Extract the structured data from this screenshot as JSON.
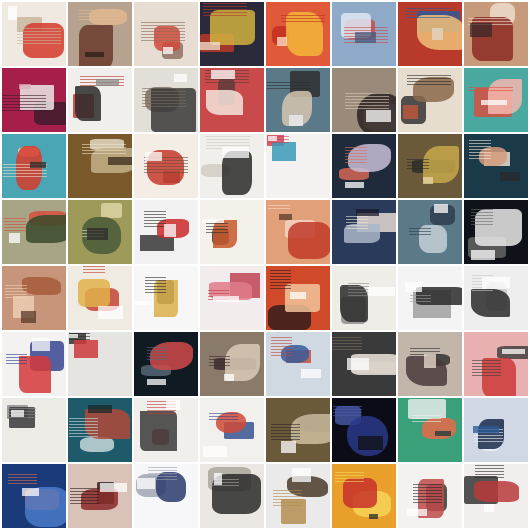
{
  "grid": {
    "rows": 8,
    "cols": 8,
    "background": "#ffffff",
    "tiles": [
      {
        "bg": "#efe9e2",
        "c1": "#d33a2c",
        "c2": "#c7b49a",
        "c3": "#ffffff"
      },
      {
        "bg": "#b7a28f",
        "c1": "#6a3b2b",
        "c2": "#e2b98f",
        "c3": "#2b1d18"
      },
      {
        "bg": "#e7ddd3",
        "c1": "#cf4a3a",
        "c2": "#8a6a5a",
        "c3": "#ffffff"
      },
      {
        "bg": "#2b2a3a",
        "c1": "#d0b140",
        "c2": "#c03a2a",
        "c3": "#f1e4cc"
      },
      {
        "bg": "#e05a3a",
        "c1": "#f2b63a",
        "c2": "#c22a22",
        "c3": "#ffe6c8"
      },
      {
        "bg": "#8fa9c9",
        "c1": "#dfe8f2",
        "c2": "#c44b4b",
        "c3": "#4a5a7a"
      },
      {
        "bg": "#b83a2b",
        "c1": "#f0c07a",
        "c2": "#2a5a9a",
        "c3": "#e3d7ca"
      },
      {
        "bg": "#c89a7c",
        "c1": "#8c2a22",
        "c2": "#efe0d0",
        "c3": "#3a2a2a"
      },
      {
        "bg": "#a61f4a",
        "c1": "#ece6e6",
        "c2": "#3a1a2a",
        "c3": "#d7b0b8"
      },
      {
        "bg": "#f0efec",
        "c1": "#2a2a2a",
        "c2": "#bb3030",
        "c3": "#8a8a8a"
      },
      {
        "bg": "#e2ded8",
        "c1": "#3a3a3a",
        "c2": "#7a6a5a",
        "c3": "#ffffff"
      },
      {
        "bg": "#c84a4a",
        "c1": "#f4e4dc",
        "c2": "#5a3a3a",
        "c3": "#ffffff"
      },
      {
        "bg": "#5a7a8a",
        "c1": "#d7c6b0",
        "c2": "#2a2a2a",
        "c3": "#eef2f4"
      },
      {
        "bg": "#9a8a7a",
        "c1": "#2a2222",
        "c2": "#d9c9b6",
        "c3": "#ffffff"
      },
      {
        "bg": "#e6ddcf",
        "c1": "#8a6a4a",
        "c2": "#2a2a2a",
        "c3": "#c85a3a"
      },
      {
        "bg": "#49a8a0",
        "c1": "#f3b7b0",
        "c2": "#e04a3a",
        "c3": "#ffffff"
      },
      {
        "bg": "#4aa6b4",
        "c1": "#d83a2a",
        "c2": "#f4dcc8",
        "c3": "#2a2a2a"
      },
      {
        "bg": "#7a5a2a",
        "c1": "#c4b08a",
        "c2": "#e9e0cc",
        "c3": "#3a2a1a"
      },
      {
        "bg": "#f3ede6",
        "c1": "#c43a2a",
        "c2": "#6a4a3a",
        "c3": "#ffffff"
      },
      {
        "bg": "#f1efeb",
        "c1": "#2a2a2a",
        "c2": "#cfcac2",
        "c3": "#ffffff"
      },
      {
        "bg": "#f4f2f0",
        "c1": "#3a9ab8",
        "c2": "#d03a4a",
        "c3": "#ffffff"
      },
      {
        "bg": "#1f2a3a",
        "c1": "#c8c0d8",
        "c2": "#e06a5a",
        "c3": "#ffffff"
      },
      {
        "bg": "#6a5a3a",
        "c1": "#c5a84a",
        "c2": "#2a2a2a",
        "c3": "#e8d8a8"
      },
      {
        "bg": "#1a3a4a",
        "c1": "#d59a7a",
        "c2": "#f3e8d8",
        "c3": "#2a2a2a"
      },
      {
        "bg": "#a8a486",
        "c1": "#3a4a2a",
        "c2": "#d74a3a",
        "c3": "#ffffff"
      },
      {
        "bg": "#9d9a5a",
        "c1": "#4a5a3a",
        "c2": "#e1d7a8",
        "c3": "#2a2a2a"
      },
      {
        "bg": "#f2f2f2",
        "c1": "#cc2a2a",
        "c2": "#2a2a2a",
        "c3": "#ffffff"
      },
      {
        "bg": "#f4f0ea",
        "c1": "#c8582a",
        "c2": "#2a2a2a",
        "c3": "#ffffff"
      },
      {
        "bg": "#e2a07a",
        "c1": "#c13a2a",
        "c2": "#f5d8c8",
        "c3": "#5a3a2a"
      },
      {
        "bg": "#2a3a5a",
        "c1": "#aab6c8",
        "c2": "#f1e4da",
        "c3": "#1a1a2a"
      },
      {
        "bg": "#5a7a8a",
        "c1": "#c5d0d6",
        "c2": "#2a3a4a",
        "c3": "#ffffff"
      },
      {
        "bg": "#0f1218",
        "c1": "#eaeaea",
        "c2": "#6a6a6a",
        "c3": "#ffffff"
      },
      {
        "bg": "#c7967a",
        "c1": "#a45a3a",
        "c2": "#f0d0b8",
        "c3": "#5a3a2a"
      },
      {
        "bg": "#f0ebe2",
        "c1": "#e0b04a",
        "c2": "#c0392b",
        "c3": "#ffffff"
      },
      {
        "bg": "#f7f7f7",
        "c1": "#d9b04a",
        "c2": "#2a2a2a",
        "c3": "#ffffff"
      },
      {
        "bg": "#f3ecec",
        "c1": "#e07a8a",
        "c2": "#bb3a4a",
        "c3": "#ffffff"
      },
      {
        "bg": "#d04a2a",
        "c1": "#f2c49a",
        "c2": "#2a1a1a",
        "c3": "#ffffff"
      },
      {
        "bg": "#efede8",
        "c1": "#2a2a2a",
        "c2": "#8a8a8a",
        "c3": "#ffffff"
      },
      {
        "bg": "#f4f4f4",
        "c1": "#2a2a2a",
        "c2": "#9a9a9a",
        "c3": "#ffffff"
      },
      {
        "bg": "#eeeeee",
        "c1": "#2a2a2a",
        "c2": "#c8c8c8",
        "c3": "#ffffff"
      },
      {
        "bg": "#f3f2f0",
        "c1": "#d43a3a",
        "c2": "#2a3a8a",
        "c3": "#ffffff"
      },
      {
        "bg": "#e6e4e0",
        "c1": "#cc3a3a",
        "c2": "#2a2a2a",
        "c3": "#ffffff"
      },
      {
        "bg": "#0f1a22",
        "c1": "#cf4a4a",
        "c2": "#5a6a7a",
        "c3": "#ffffff"
      },
      {
        "bg": "#8a7a6a",
        "c1": "#d9cbb8",
        "c2": "#3a2a2a",
        "c3": "#ffffff"
      },
      {
        "bg": "#d0d8e2",
        "c1": "#3a5a9a",
        "c2": "#c04a3a",
        "c3": "#ffffff"
      },
      {
        "bg": "#3a3a3a",
        "c1": "#efe6de",
        "c2": "#7a6a5a",
        "c3": "#ffffff"
      },
      {
        "bg": "#c2b6ab",
        "c1": "#4a3a3a",
        "c2": "#2a2a2a",
        "c3": "#efe2d6"
      },
      {
        "bg": "#e8b0b0",
        "c1": "#cc3a3a",
        "c2": "#3a3a3a",
        "c3": "#ffffff"
      },
      {
        "bg": "#ecebe6",
        "c1": "#3a3a3a",
        "c2": "#8a8a8a",
        "c3": "#ffffff"
      },
      {
        "bg": "#1e5a6a",
        "c1": "#b04a3a",
        "c2": "#d0e0e0",
        "c3": "#1a2a2a"
      },
      {
        "bg": "#f0efec",
        "c1": "#3a3a3a",
        "c2": "#c43a3a",
        "c3": "#ffffff"
      },
      {
        "bg": "#f2f0ec",
        "c1": "#d04a3a",
        "c2": "#2a4a8a",
        "c3": "#ffffff"
      },
      {
        "bg": "#6a5a3a",
        "c1": "#d0c0a0",
        "c2": "#2a2a2a",
        "c3": "#ffffff"
      },
      {
        "bg": "#0c0c16",
        "c1": "#2a3a8a",
        "c2": "#4a5aaa",
        "c3": "#111111"
      },
      {
        "bg": "#3aa07a",
        "c1": "#e86a4a",
        "c2": "#f0f0f0",
        "c3": "#1a3a3a"
      },
      {
        "bg": "#cfd8e4",
        "c1": "#1a2a4a",
        "c2": "#f0f4f8",
        "c3": "#2a5a9a"
      },
      {
        "bg": "#1a3a7a",
        "c1": "#4a7ac8",
        "c2": "#e06a4a",
        "c3": "#ffffff"
      },
      {
        "bg": "#d9c2b8",
        "c1": "#8a2a2a",
        "c2": "#2a1a1a",
        "c3": "#ffffff"
      },
      {
        "bg": "#f7f7fa",
        "c1": "#2a3a6a",
        "c2": "#9aa0b0",
        "c3": "#ffffff"
      },
      {
        "bg": "#ebe8e3",
        "c1": "#2a2a2a",
        "c2": "#a8a29a",
        "c3": "#ffffff"
      },
      {
        "bg": "#eaeaea",
        "c1": "#4a3a2a",
        "c2": "#b08a4a",
        "c3": "#ffffff"
      },
      {
        "bg": "#e9a02a",
        "c1": "#c8302a",
        "c2": "#f6d85a",
        "c3": "#2a2a2a"
      },
      {
        "bg": "#f4f2ef",
        "c1": "#c04a4a",
        "c2": "#2a2a2a",
        "c3": "#ffffff"
      },
      {
        "bg": "#f2eeee",
        "c1": "#b83a3a",
        "c2": "#2a2a2a",
        "c3": "#ffffff"
      }
    ]
  }
}
